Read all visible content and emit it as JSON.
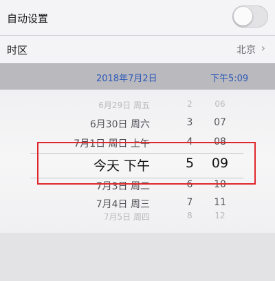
{
  "settings": {
    "auto_label": "自动设置",
    "auto_enabled": false,
    "timezone_label": "时区",
    "timezone_value": "北京",
    "chevron": "chevron-right-icon"
  },
  "selection": {
    "date": "2018年7月2日",
    "time": "下午5:09"
  },
  "picker": {
    "rows": [
      {
        "date": "6月29日 周五",
        "hour": "2",
        "minute": "06"
      },
      {
        "date": "6月30日 周六",
        "hour": "3",
        "minute": "07"
      },
      {
        "date": "7月1日 周日 上午",
        "hour": "4",
        "minute": "08"
      },
      {
        "date": "今天        下午",
        "hour": "5",
        "minute": "09"
      },
      {
        "date": "7月3日 周二",
        "hour": "6",
        "minute": "10"
      },
      {
        "date": "7月4日 周三",
        "hour": "7",
        "minute": "11"
      },
      {
        "date": "7月5日 周四",
        "hour": "8",
        "minute": "12"
      }
    ]
  },
  "colors": {
    "accent_blue": "#2b57b7",
    "highlight_red": "#e0262a"
  }
}
